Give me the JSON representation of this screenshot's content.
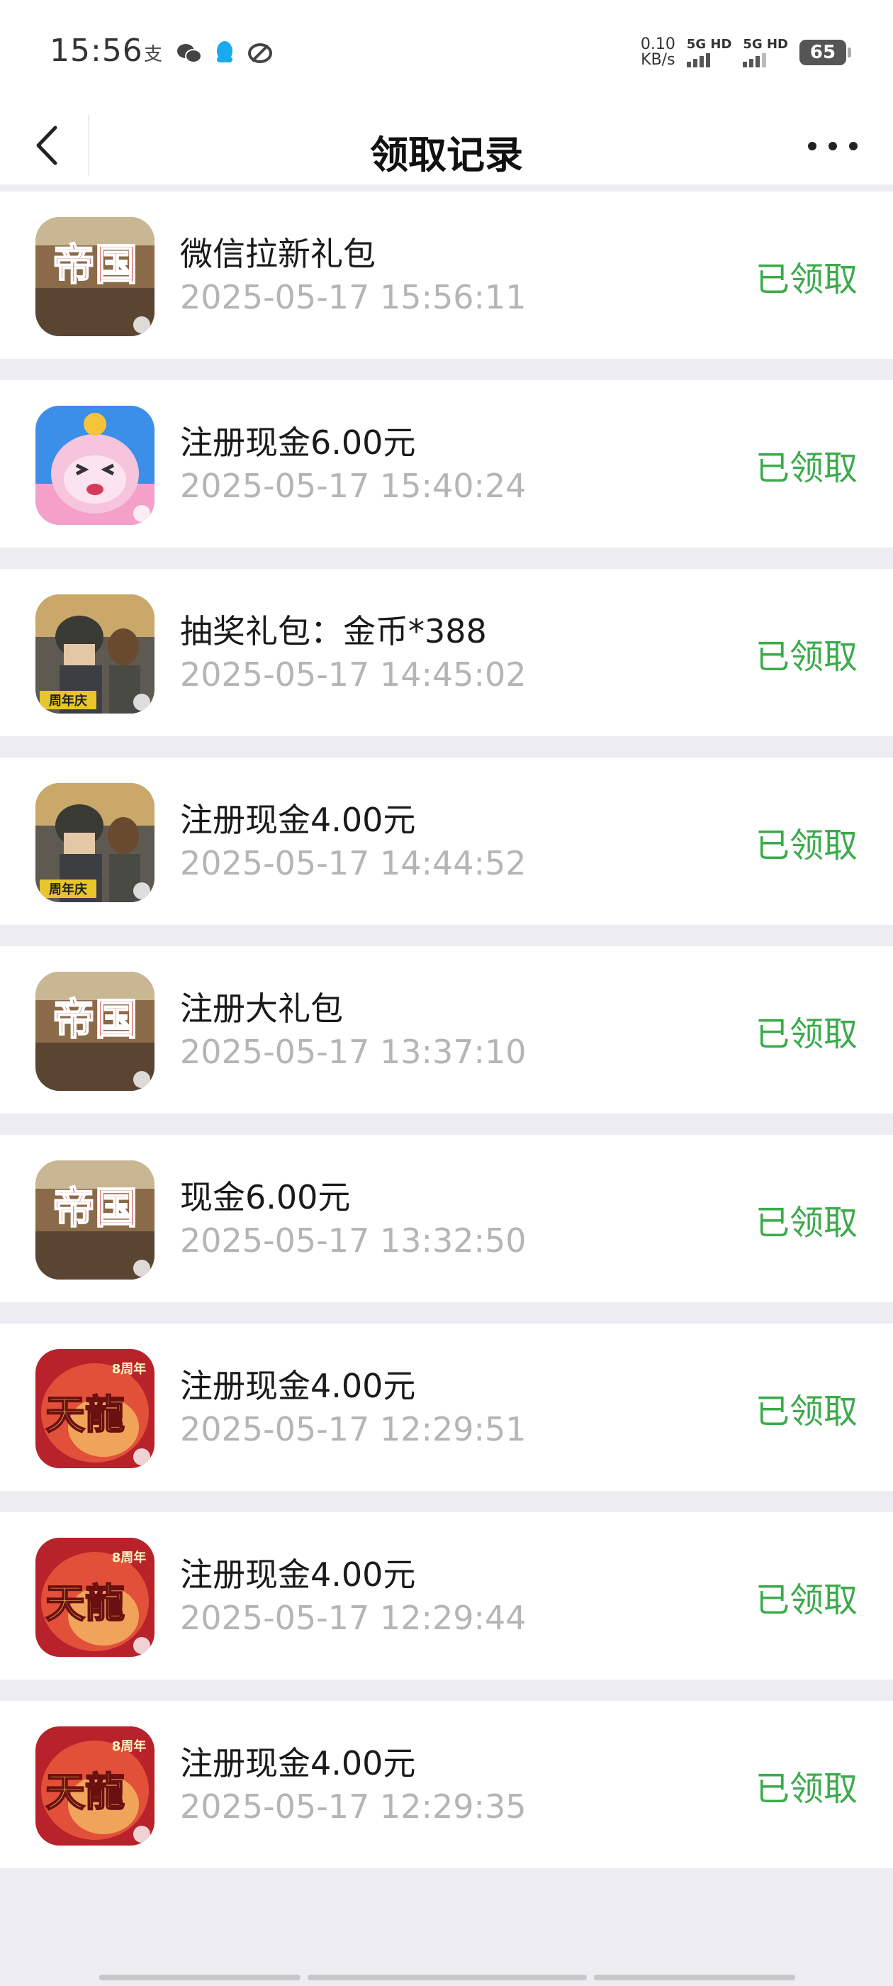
{
  "status_bar": {
    "time": "15:56",
    "icons": [
      "alipay-icon",
      "wechat-icon",
      "qq-icon",
      "link-icon"
    ],
    "net_speed_value": "0.10",
    "net_speed_unit": "KB/s",
    "sim1_label": "5G HD",
    "sim2_label": "5G HD",
    "battery": "65"
  },
  "navbar": {
    "title": "领取记录"
  },
  "records": [
    {
      "icon": "diguo-game-icon",
      "title": "微信拉新礼包",
      "time": "2025-05-17 15:56:11",
      "status": "已领取"
    },
    {
      "icon": "cat-game-icon",
      "title": "注册现金6.00元",
      "time": "2025-05-17 15:40:24",
      "status": "已领取"
    },
    {
      "icon": "pubg-game-icon",
      "title": "抽奖礼包：金币*388",
      "time": "2025-05-17 14:45:02",
      "status": "已领取"
    },
    {
      "icon": "pubg-game-icon",
      "title": "注册现金4.00元",
      "time": "2025-05-17 14:44:52",
      "status": "已领取"
    },
    {
      "icon": "diguo-game-icon",
      "title": "注册大礼包",
      "time": "2025-05-17 13:37:10",
      "status": "已领取"
    },
    {
      "icon": "diguo-game-icon",
      "title": "现金6.00元",
      "time": "2025-05-17 13:32:50",
      "status": "已领取"
    },
    {
      "icon": "tianlong-game-icon",
      "title": "注册现金4.00元",
      "time": "2025-05-17 12:29:51",
      "status": "已领取"
    },
    {
      "icon": "tianlong-game-icon",
      "title": "注册现金4.00元",
      "time": "2025-05-17 12:29:44",
      "status": "已领取"
    },
    {
      "icon": "tianlong-game-icon",
      "title": "注册现金4.00元",
      "time": "2025-05-17 12:29:35",
      "status": "已领取"
    }
  ],
  "icon_text": {
    "diguo": "帝国",
    "tianlong": "天龍",
    "tianlong_badge": "8周年",
    "pubg_badge": "周年庆"
  },
  "colors": {
    "status_green": "#3bab4b",
    "background": "#ededf1",
    "time_gray": "#b5b5b5"
  }
}
